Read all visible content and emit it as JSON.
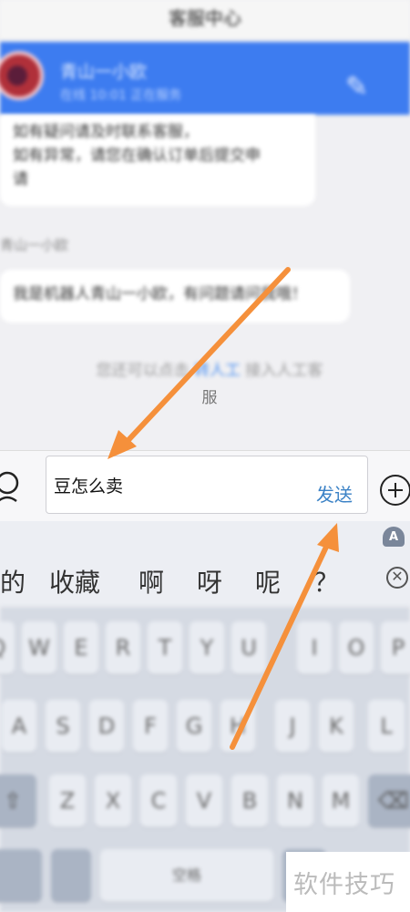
{
  "title": "客服中心",
  "banner": {
    "name": "青山一小欧",
    "subtitle": "在线 10:01  正在服务"
  },
  "chat": {
    "bubble1_line1": "如有疑问请及时联系客服，",
    "bubble1_line2": "如有异常，请您在确认订单后提交申",
    "bubble1_line3": "请",
    "sender2": "青山一小欧",
    "bubble2": "我是机器人青山一小欧，有问题请问我哦！",
    "system_prefix": "您还可以点击 ",
    "system_link": "转人工",
    "system_suffix": " 接入人工客",
    "system_end": "服"
  },
  "input": {
    "value": "豆怎么卖",
    "send_label": "发送"
  },
  "candidates": [
    "的",
    "收藏",
    "啊",
    "呀",
    "呢",
    "？"
  ],
  "keyboard": {
    "row1": [
      "Q",
      "W",
      "E",
      "R",
      "T",
      "Y",
      "U",
      "I",
      "O",
      "P"
    ],
    "row2": [
      "A",
      "S",
      "D",
      "F",
      "G",
      "H",
      "J",
      "K",
      "L"
    ],
    "row3": [
      "Z",
      "X",
      "C",
      "V",
      "B",
      "N",
      "M"
    ],
    "shift": "⇧",
    "backspace": "⌫",
    "space": "空格"
  },
  "watermark": "软件技巧",
  "colors": {
    "banner": "#3d7cf0",
    "send": "#3b82c6",
    "arrow": "#f5903b"
  }
}
